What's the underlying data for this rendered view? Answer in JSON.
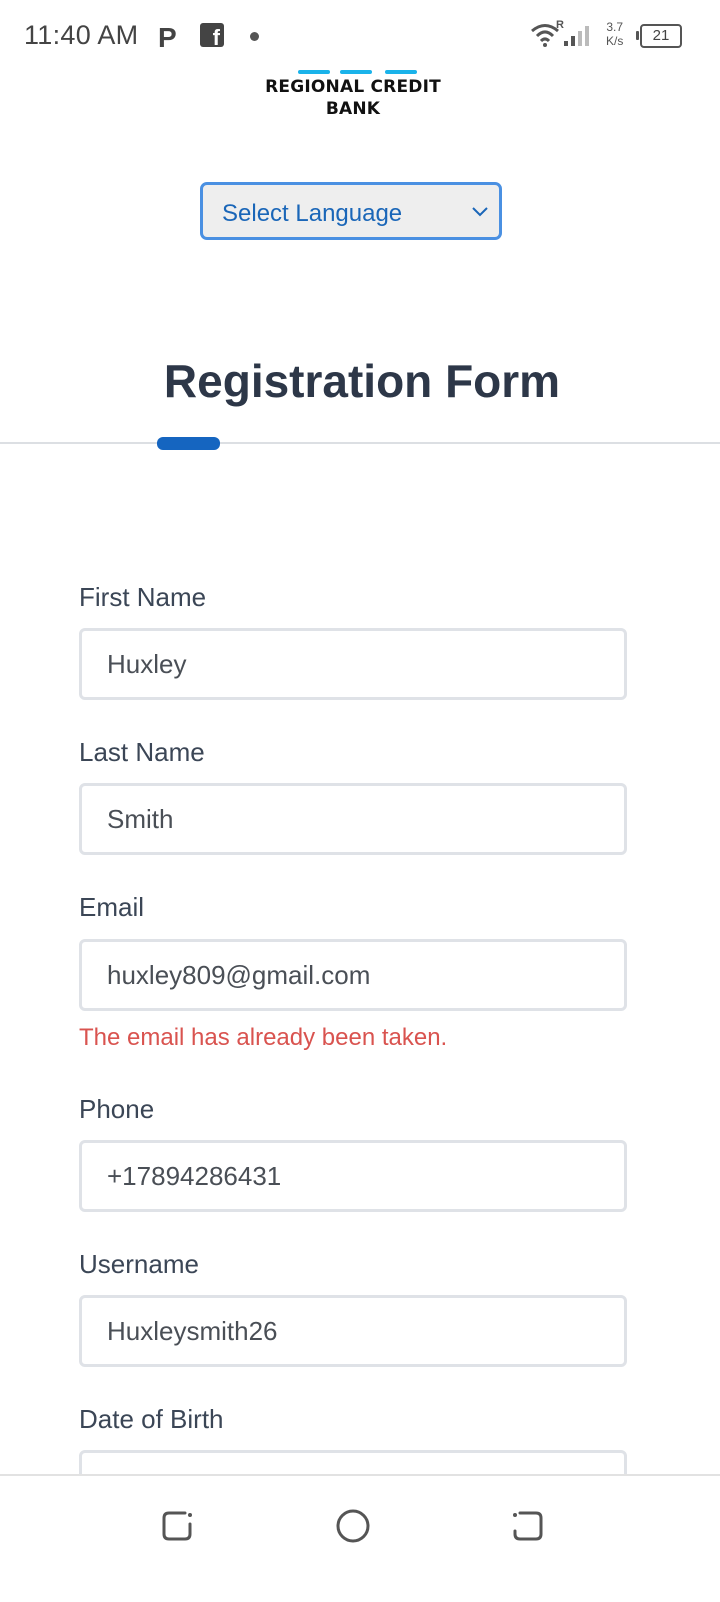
{
  "status_bar": {
    "time": "11:40 AM",
    "parking_icon": "P",
    "facebook_icon": "f",
    "network_speed_value": "3.7",
    "network_speed_unit": "K/s",
    "wifi_badge": "R",
    "battery_level": "21"
  },
  "logo": {
    "line1": "REGIONAL CREDIT",
    "line2": "BANK",
    "accent_color": "#1ab3ea"
  },
  "language_select": {
    "selected": "Select Language"
  },
  "form": {
    "title": "Registration Form",
    "accent_color": "#1565c0",
    "fields": [
      {
        "label": "First Name",
        "value": "Huxley"
      },
      {
        "label": "Last Name",
        "value": "Smith"
      },
      {
        "label": "Email",
        "value": "huxley809@gmail.com",
        "error": "The email has already been taken."
      },
      {
        "label": "Phone",
        "value": "+17894286431"
      },
      {
        "label": "Username",
        "value": "Huxleysmith26"
      },
      {
        "label": "Date of Birth",
        "value": ""
      }
    ]
  },
  "nav_bar": {
    "icons": [
      "recent-apps-icon",
      "home-icon",
      "back-icon"
    ]
  }
}
